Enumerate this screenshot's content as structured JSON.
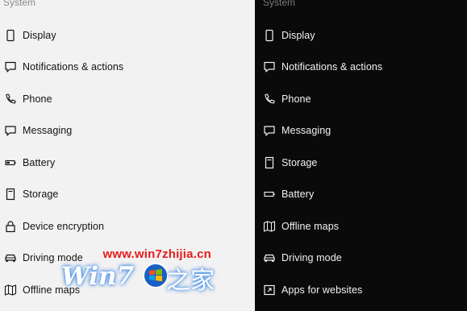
{
  "light_panel": {
    "header": "System",
    "items": [
      {
        "label": "Display",
        "icon": "phone-icon"
      },
      {
        "label": "Notifications & actions",
        "icon": "message-icon"
      },
      {
        "label": "Phone",
        "icon": "handset-icon"
      },
      {
        "label": "Messaging",
        "icon": "chat-icon"
      },
      {
        "label": "Battery",
        "icon": "battery-icon"
      },
      {
        "label": "Storage",
        "icon": "storage-icon"
      },
      {
        "label": "Device encryption",
        "icon": "lock-icon"
      },
      {
        "label": "Driving mode",
        "icon": "car-icon"
      },
      {
        "label": "Offline maps",
        "icon": "map-icon"
      }
    ]
  },
  "dark_panel": {
    "header": "System",
    "items": [
      {
        "label": "Display",
        "icon": "phone-icon"
      },
      {
        "label": "Notifications & actions",
        "icon": "message-icon"
      },
      {
        "label": "Phone",
        "icon": "handset-icon"
      },
      {
        "label": "Messaging",
        "icon": "chat-icon"
      },
      {
        "label": "Storage",
        "icon": "storage-icon"
      },
      {
        "label": "Battery",
        "icon": "battery-icon"
      },
      {
        "label": "Offline maps",
        "icon": "map-icon"
      },
      {
        "label": "Driving mode",
        "icon": "car-icon"
      },
      {
        "label": "Apps for websites",
        "icon": "apps-icon"
      }
    ]
  },
  "watermark": {
    "url": "www.win7zhijia.cn",
    "logo": "Win7",
    "cn": "之家"
  },
  "colors": {
    "light_bg": "#f2f2f2",
    "dark_bg": "#0a0a0a",
    "watermark_red": "#e61b1b"
  }
}
